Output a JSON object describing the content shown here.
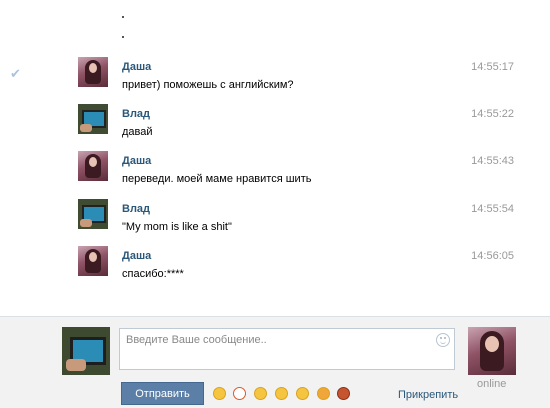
{
  "messages": [
    {
      "author": "Даша",
      "text": "привет) поможешь с английским?",
      "time": "14:55:17",
      "avatar": "dasha"
    },
    {
      "author": "Влад",
      "text": "давай",
      "time": "14:55:22",
      "avatar": "vlad"
    },
    {
      "author": "Даша",
      "text": "переведи. моей маме нравится шить",
      "time": "14:55:43",
      "avatar": "dasha"
    },
    {
      "author": "Влад",
      "text": "\"My mom is like a shit\"",
      "time": "14:55:54",
      "avatar": "vlad"
    },
    {
      "author": "Даша",
      "text": "спасибо:****",
      "time": "14:56:05",
      "avatar": "dasha"
    }
  ],
  "composer": {
    "placeholder": "Введите Ваше сообщение..",
    "send_label": "Отправить",
    "attach_label": "Прикрепить",
    "status": "online",
    "emoji_icons": [
      "emoji-1-icon",
      "emoji-2-icon",
      "emoji-3-icon",
      "emoji-4-icon",
      "emoji-5-icon",
      "emoji-6-icon",
      "emoji-7-icon"
    ]
  },
  "colors": {
    "name_color": "#2b587a",
    "button_color": "#5b7fa6",
    "time_color": "#999999"
  }
}
